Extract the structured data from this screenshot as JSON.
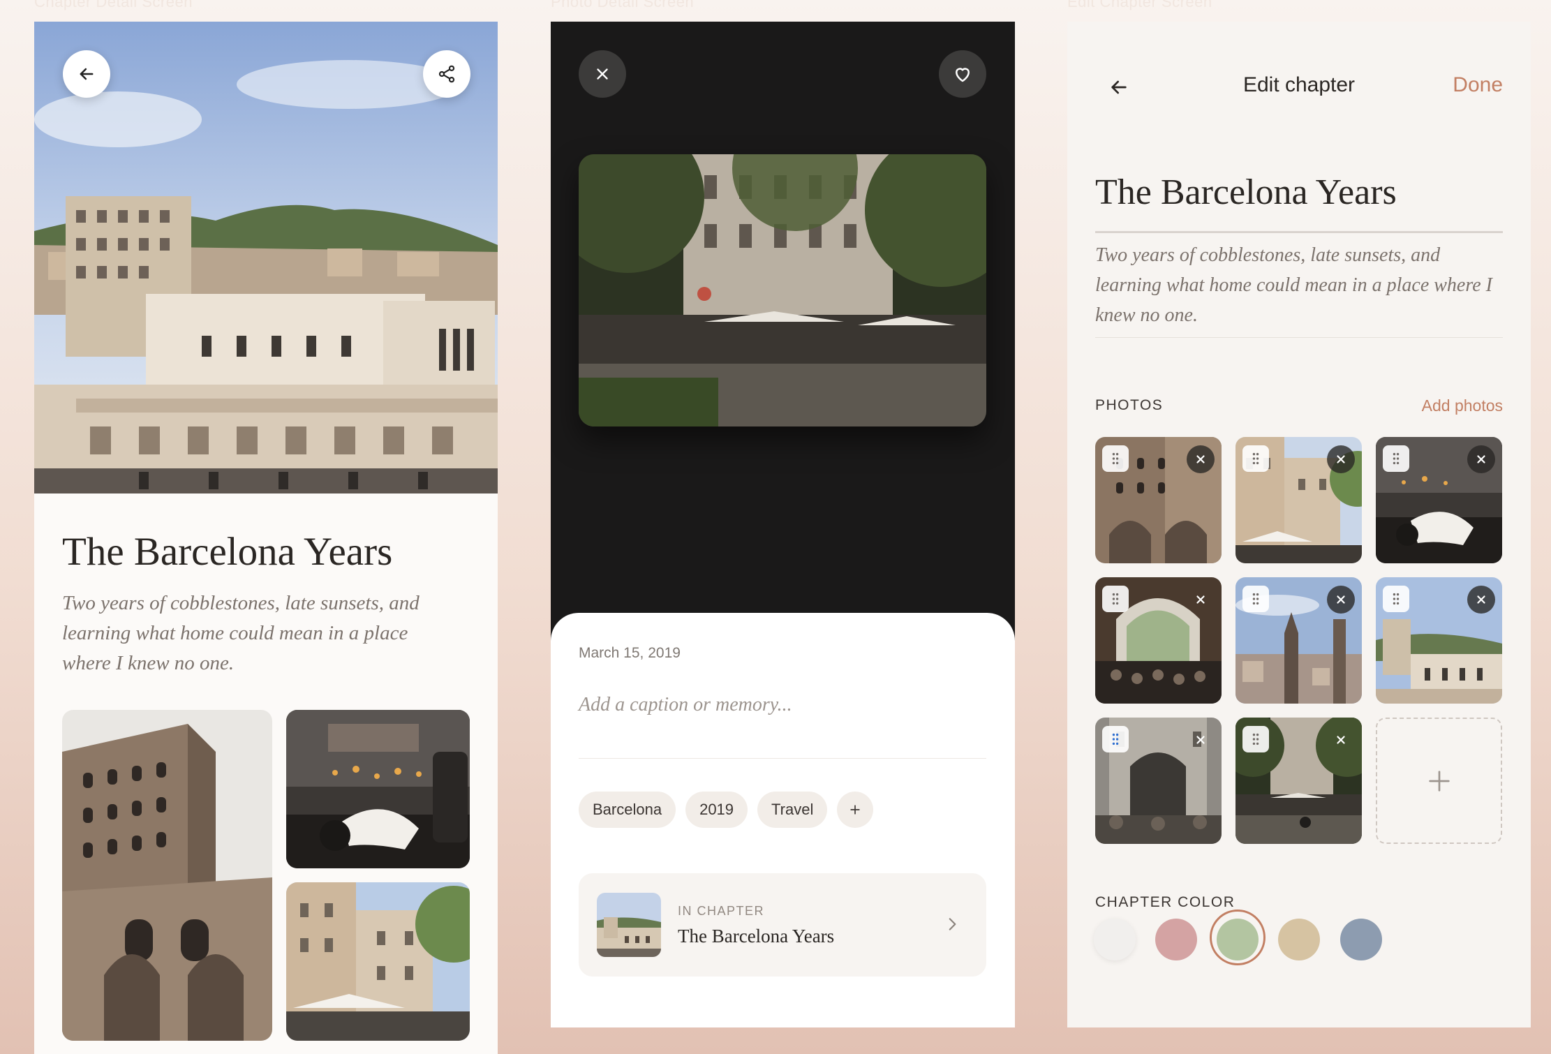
{
  "screen_labels": [
    "Chapter Detail Screen",
    "Photo Detail Screen",
    "Edit Chapter Screen"
  ],
  "chapter_detail": {
    "title": "The Barcelona Years",
    "description": "Two years of cobblestones, late sunsets, and learning what home could mean in a place where I knew no one."
  },
  "photo_detail": {
    "date": "March 15, 2019",
    "caption_placeholder": "Add a caption or memory...",
    "tags": [
      "Barcelona",
      "2019",
      "Travel"
    ],
    "chapter_eyebrow": "IN CHAPTER",
    "chapter_name": "The Barcelona Years"
  },
  "edit_chapter": {
    "nav_title": "Edit chapter",
    "done_label": "Done",
    "title": "The Barcelona Years",
    "description": "Two years of cobblestones, late sunsets, and learning what home could mean in a place where I knew no one.",
    "photos_label": "PHOTOS",
    "add_photos_label": "Add photos",
    "color_label": "CHAPTER COLOR",
    "colors": [
      "#f1efed",
      "#d4a3a3",
      "#b3c5a1",
      "#d6c3a2",
      "#8d9cb0"
    ],
    "selected_color_index": 2
  },
  "colors": {
    "accent": "#c27f63",
    "ink": "#2a2623",
    "muted": "#7b726c",
    "dark_bg": "#1a1919"
  }
}
